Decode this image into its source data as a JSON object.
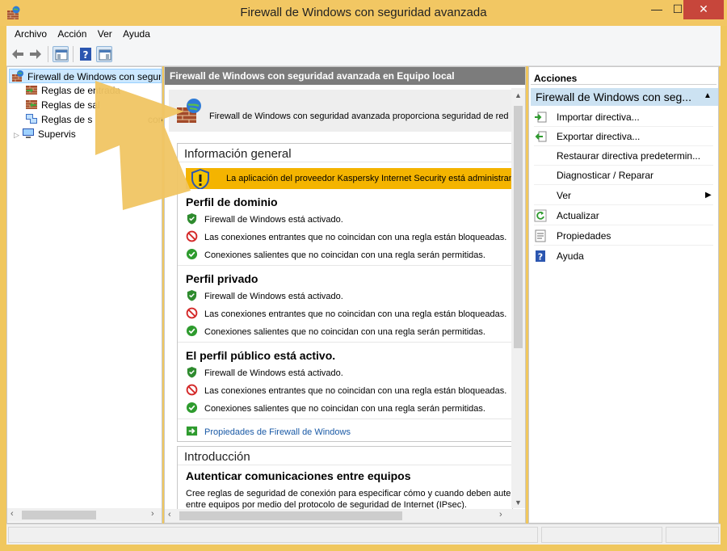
{
  "window": {
    "title": "Firewall de Windows con seguridad avanzada",
    "min": "—",
    "max": "☐",
    "close": "✕"
  },
  "menu": [
    "Archivo",
    "Acción",
    "Ver",
    "Ayuda"
  ],
  "tree": {
    "root": "Firewall de Windows con segur",
    "items": [
      "Reglas de entrada",
      "Reglas de sal",
      "Reglas de s",
      "con",
      "Supervis"
    ]
  },
  "middle": {
    "header": "Firewall de Windows con seguridad avanzada en Equipo local",
    "banner_text": "Firewall de Windows con seguridad avanzada proporciona seguridad de red par",
    "overview": {
      "title": "Información general",
      "warning": "La aplicación del proveedor Kaspersky Internet Security está administrando",
      "profiles": [
        {
          "title": "Perfil de dominio",
          "lines": [
            "Firewall de Windows está activado.",
            "Las conexiones entrantes que no coincidan con una regla están bloqueadas.",
            "Conexiones salientes que no coincidan con una regla serán permitidas."
          ]
        },
        {
          "title": "Perfil privado",
          "lines": [
            "Firewall de Windows está activado.",
            "Las conexiones entrantes que no coincidan con una regla están bloqueadas.",
            "Conexiones salientes que no coincidan con una regla serán permitidas."
          ]
        },
        {
          "title": "El perfil público está activo.",
          "lines": [
            "Firewall de Windows está activado.",
            "Las conexiones entrantes que no coincidan con una regla están bloqueadas.",
            "Conexiones salientes que no coincidan con una regla serán permitidas."
          ]
        }
      ],
      "link": "Propiedades de Firewall de Windows"
    },
    "intro": {
      "title": "Introducción",
      "subtitle": "Autenticar comunicaciones entre equipos",
      "line1": "Cree reglas de seguridad de conexión para especificar cómo y cuando deben autentic",
      "line2": "entre equipos por medio del protocolo de seguridad de Internet (IPsec)."
    }
  },
  "actions": {
    "header": "Acciones",
    "section": "Firewall de Windows con seg...",
    "items": [
      "Importar directiva...",
      "Exportar directiva...",
      "Restaurar directiva predetermin...",
      "Diagnosticar / Reparar",
      "Ver",
      "Actualizar",
      "Propiedades",
      "Ayuda"
    ]
  },
  "colors": {
    "titlebar": "#f2c763",
    "warning": "#f4b400",
    "selection": "#cce8ff",
    "link": "#1a5aa6"
  }
}
